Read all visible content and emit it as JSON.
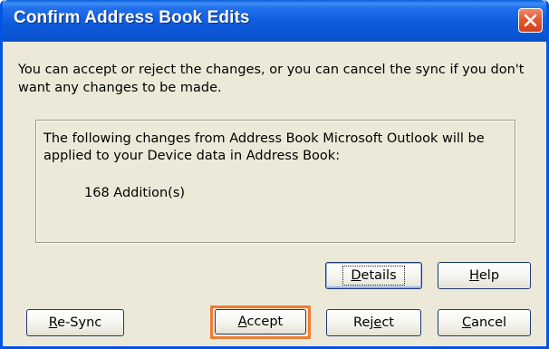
{
  "dialog": {
    "title": "Confirm Address Book Edits",
    "intro_text": "You can accept or reject the changes, or you can cancel the sync if you don't want any changes to be made.",
    "changes_text": "The following changes from Address Book Microsoft Outlook will be applied to your Device data in Address Book:",
    "count_text": "168 Addition(s)"
  },
  "buttons": {
    "details": {
      "mnemonic": "D",
      "rest": "etails"
    },
    "help": {
      "mnemonic": "H",
      "rest": "elp"
    },
    "resync": {
      "mnemonic": "R",
      "rest": "e-Sync"
    },
    "accept": {
      "mnemonic": "A",
      "rest": "ccept"
    },
    "reject": {
      "prefix": "Rej",
      "mnemonic": "e",
      "rest": "ct"
    },
    "cancel": {
      "mnemonic": "C",
      "rest": "ancel"
    }
  },
  "colors": {
    "titlebar": "#0a55d4",
    "accent_highlight": "#f07c32",
    "dialog_background": "#ece9d8"
  },
  "icons": {
    "close": "close-x-icon"
  }
}
